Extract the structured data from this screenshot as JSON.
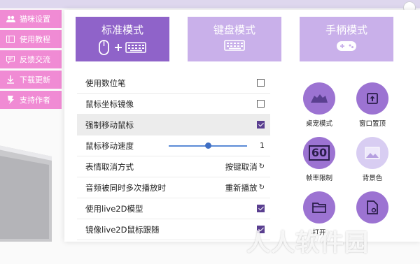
{
  "sidebar": {
    "items": [
      {
        "label": "猫咪设置",
        "icon": "users-icon"
      },
      {
        "label": "使用教程",
        "icon": "book-icon"
      },
      {
        "label": "反馈交流",
        "icon": "chat-icon"
      },
      {
        "label": "下载更新",
        "icon": "download-icon"
      },
      {
        "label": "支持作者",
        "icon": "support-icon"
      }
    ]
  },
  "modes": [
    {
      "label": "标准模式",
      "active": true,
      "icon": "mouse-keyboard-icon"
    },
    {
      "label": "键盘模式",
      "active": false,
      "icon": "keyboard-icon"
    },
    {
      "label": "手柄模式",
      "active": false,
      "icon": "gamepad-icon"
    }
  ],
  "settings": {
    "use_pen": {
      "label": "使用数位笔",
      "checked": false
    },
    "mirror_coords": {
      "label": "鼠标坐标镜像",
      "checked": false
    },
    "force_move": {
      "label": "强制移动鼠标",
      "checked": true
    },
    "move_speed": {
      "label": "鼠标移动速度",
      "value": "1",
      "fraction": 0.5
    },
    "emotion_cancel": {
      "label": "表情取消方式",
      "value": "按键取消"
    },
    "audio_replay": {
      "label": "音频被同时多次播放时",
      "value": "重新播放"
    },
    "use_live2d": {
      "label": "使用live2D模型",
      "checked": true
    },
    "mirror_live2d": {
      "label": "镜像live2D鼠标跟随",
      "checked": true
    }
  },
  "quick_actions": [
    {
      "label": "桌宠模式",
      "icon": "desk-pet-icon"
    },
    {
      "label": "窗口置顶",
      "icon": "pin-top-icon"
    },
    {
      "label": "帧率限制",
      "icon": "fps-icon",
      "text": "60"
    },
    {
      "label": "背景色",
      "icon": "background-color-icon"
    },
    {
      "label": "打开",
      "icon": "folder-icon"
    },
    {
      "label": "",
      "icon": "file-settings-icon"
    }
  ],
  "watermark": "人人软件园",
  "colors": {
    "accent": "#8f63c9",
    "accent_light": "#c9b0ea",
    "sidebar": "#f08bd4"
  }
}
